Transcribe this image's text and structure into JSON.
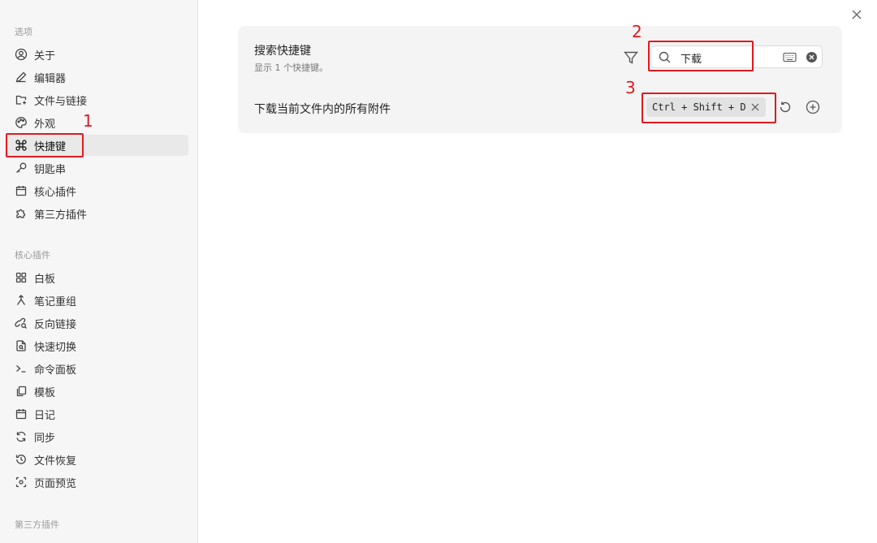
{
  "sidebar": {
    "section_options": "选项",
    "options_items": [
      {
        "label": "关于",
        "icon": "user-circle-icon"
      },
      {
        "label": "编辑器",
        "icon": "pencil-icon"
      },
      {
        "label": "文件与链接",
        "icon": "folder-link-icon"
      },
      {
        "label": "外观",
        "icon": "palette-icon"
      },
      {
        "label": "快捷键",
        "icon": "command-icon",
        "active": true
      },
      {
        "label": "钥匙串",
        "icon": "key-icon"
      },
      {
        "label": "核心插件",
        "icon": "calendar-box-icon"
      },
      {
        "label": "第三方插件",
        "icon": "puzzle-icon"
      }
    ],
    "section_core": "核心插件",
    "core_items": [
      {
        "label": "白板",
        "icon": "grid-icon"
      },
      {
        "label": "笔记重组",
        "icon": "merge-icon"
      },
      {
        "label": "反向链接",
        "icon": "link-search-icon"
      },
      {
        "label": "快速切换",
        "icon": "file-search-icon"
      },
      {
        "label": "命令面板",
        "icon": "terminal-icon"
      },
      {
        "label": "模板",
        "icon": "copy-icon"
      },
      {
        "label": "日记",
        "icon": "calendar-icon"
      },
      {
        "label": "同步",
        "icon": "sync-icon"
      },
      {
        "label": "文件恢复",
        "icon": "history-icon"
      },
      {
        "label": "页面预览",
        "icon": "preview-icon"
      }
    ],
    "section_third": "第三方插件"
  },
  "hotkeys": {
    "title": "搜索快捷键",
    "subtitle": "显示 1 个快捷键。",
    "search_value": "下载",
    "command_label": "下载当前文件内的所有附件",
    "hotkey_label": "Ctrl + Shift + D"
  },
  "annotations": {
    "n1": "1",
    "n2": "2",
    "n3": "3",
    "color": "#e0191f"
  },
  "colors": {
    "sidebar_bg": "#f6f6f6",
    "panel_bg": "#f4f4f4",
    "active_item_bg": "#e9e9e9",
    "annotation": "#e0191f"
  }
}
